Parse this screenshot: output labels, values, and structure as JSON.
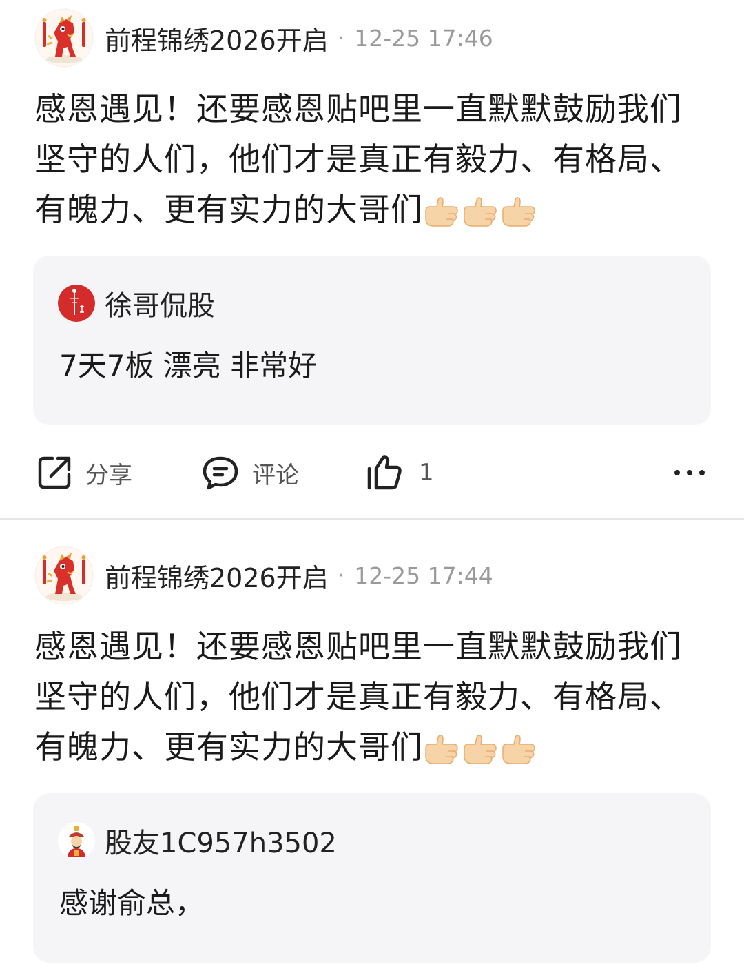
{
  "posts": [
    {
      "author": "前程锦绣2026开启",
      "separator": "·",
      "time": "12-25 17:46",
      "content": "感恩遇见！还要感恩贴吧里一直默默鼓励我们坚守的人们，他们才是真正有毅力、有格局、有魄力、更有实力的大哥们",
      "emoji": [
        "thumbs-up",
        "thumbs-up",
        "thumbs-up"
      ],
      "quote": {
        "author": "徐哥侃股",
        "text": "7天7板 漂亮 非常好"
      },
      "actions": {
        "share_label": "分享",
        "comment_label": "评论",
        "like_count": "1",
        "more_icon": "more-dots-icon"
      }
    },
    {
      "author": "前程锦绣2026开启",
      "separator": "·",
      "time": "12-25 17:44",
      "content": "感恩遇见！还要感恩贴吧里一直默默鼓励我们坚守的人们，他们才是真正有毅力、有格局、有魄力、更有实力的大哥们",
      "emoji": [
        "thumbs-up",
        "thumbs-up",
        "thumbs-up"
      ],
      "quote": {
        "author": "股友1C957h3502",
        "text": "感谢俞总，"
      }
    }
  ],
  "colors": {
    "quote_background": "#f5f5f7",
    "time_gray": "#9a9a9a",
    "divider": "#e6e6e6",
    "avatar_red": "#d42b2b"
  }
}
